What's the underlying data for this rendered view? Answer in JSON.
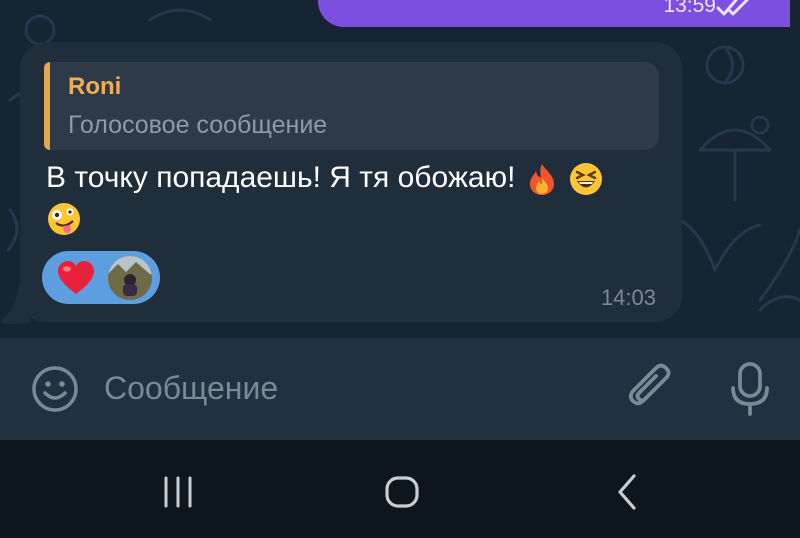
{
  "outgoing_message": {
    "time": "13:59",
    "status_icon": "double-check-icon"
  },
  "incoming_message": {
    "reply": {
      "author": "Roni",
      "text": "Голосовое сообщение"
    },
    "text": "В точку попадаешь! Я тя обожаю!",
    "emojis": [
      "fire-emoji",
      "laughing-squint-emoji",
      "zany-face-emoji"
    ],
    "reaction": {
      "emoji": "heart-emoji",
      "reactor": "avatar"
    },
    "time": "14:03"
  },
  "composer": {
    "placeholder": "Сообщение",
    "left_icon": "emoji-icon",
    "right_icons": [
      "attach-icon",
      "microphone-icon"
    ]
  },
  "system_nav": [
    "recent-apps-icon",
    "home-icon",
    "back-icon"
  ],
  "colors": {
    "chat_background": "#172432",
    "outgoing_bubble": "#7c4fe0",
    "incoming_bubble": "#202d3a",
    "reply_accent": "#efae56",
    "reaction_background": "#5c9ee0",
    "composer_background": "#223140"
  }
}
